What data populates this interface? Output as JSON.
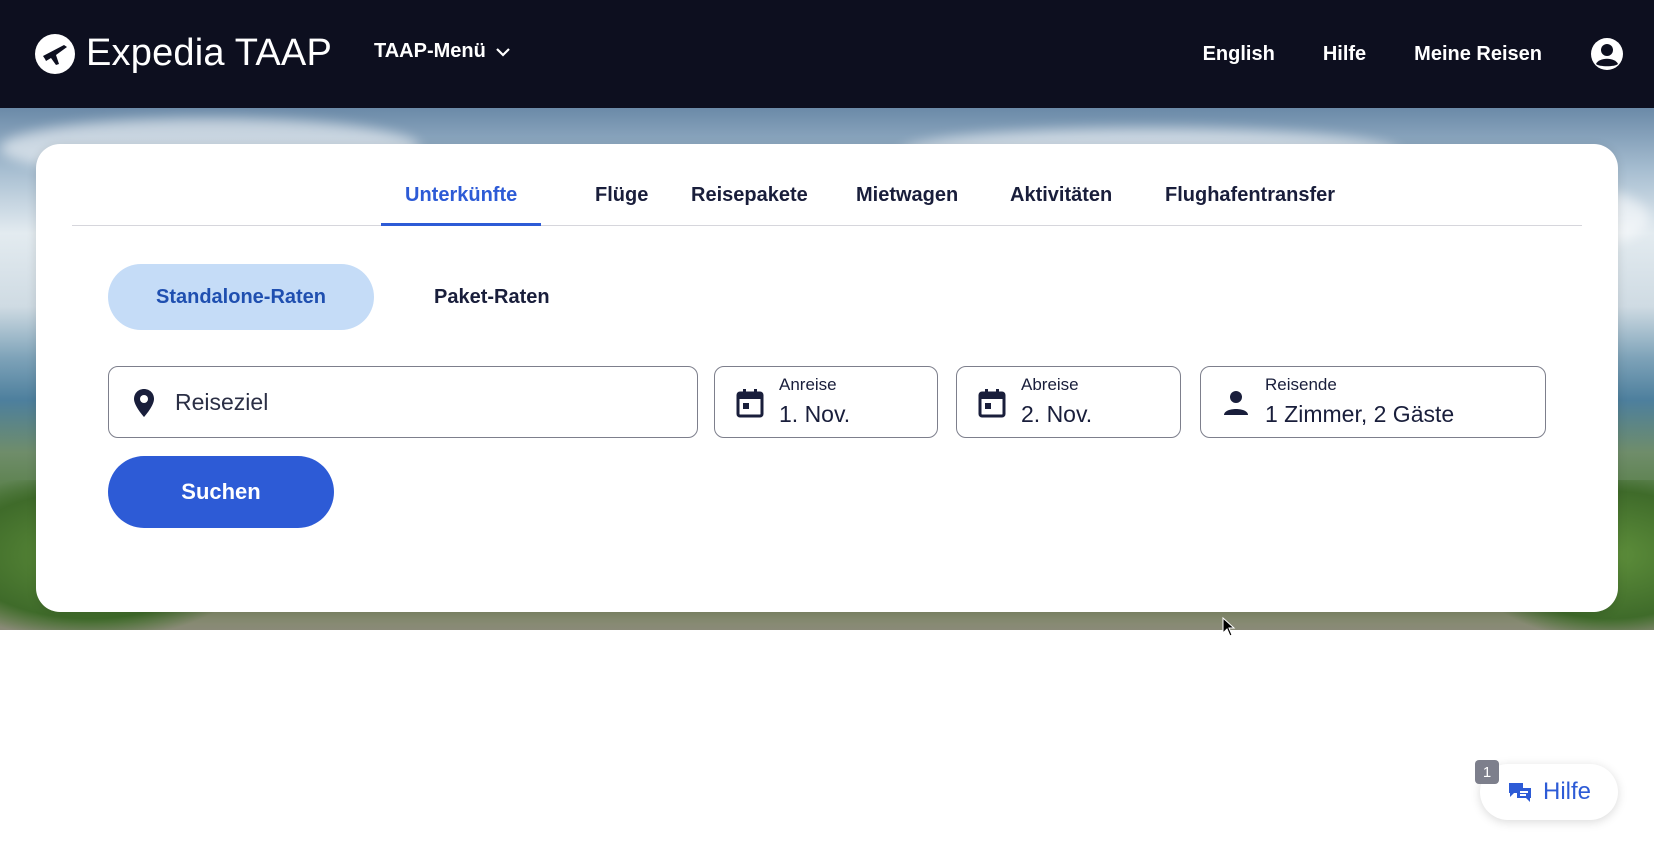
{
  "header": {
    "brand": "Expedia TAAP",
    "menu_label": "TAAP-Menü",
    "nav": [
      "English",
      "Hilfe",
      "Meine Reisen"
    ]
  },
  "search": {
    "tabs": [
      "Unterkünfte",
      "Flüge",
      "Reisepakete",
      "Mietwagen",
      "Aktivitäten",
      "Flughafentransfer"
    ],
    "active_tab": "Unterkünfte",
    "rate_options": [
      "Standalone-Raten",
      "Paket-Raten"
    ],
    "destination_placeholder": "Reiseziel",
    "checkin": {
      "label": "Anreise",
      "value": "1. Nov."
    },
    "checkout": {
      "label": "Abreise",
      "value": "2. Nov."
    },
    "travelers": {
      "label": "Reisende",
      "value": "1 Zimmer, 2 Gäste"
    },
    "submit": "Suchen"
  },
  "help": {
    "label": "Hilfe",
    "badge": "1"
  },
  "colors": {
    "header_bg": "#0d0f1f",
    "accent": "#2d5bd6",
    "active_pill": "#c5dcf7"
  }
}
